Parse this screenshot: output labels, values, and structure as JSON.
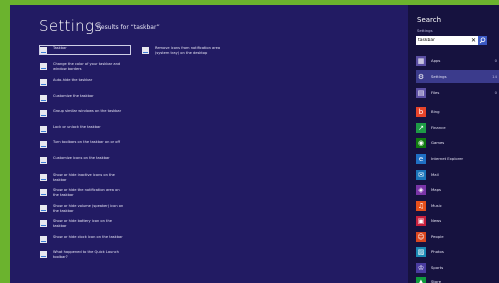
{
  "header": {
    "title": "Settings",
    "subtitle": "Results for “taskbar”"
  },
  "results_left": [
    "Taskbar",
    "Change the color of your taskbar and window borders",
    "Auto-hide the taskbar",
    "Customize the taskbar",
    "Group similar windows on the taskbar",
    "Lock or unlock the taskbar",
    "Turn toolbars on the taskbar on or off",
    "Customize icons on the taskbar",
    "Show or hide inactive icons on the taskbar",
    "Show or hide the notification area on the taskbar",
    "Show or hide volume (speaker) icon on the taskbar",
    "Show or hide battery icon on the taskbar",
    "Show or hide clock icon on the taskbar",
    "What happened to the Quick Launch toolbar?"
  ],
  "results_right": [
    "Remove icons from notification area (system tray) on the desktop"
  ],
  "charm": {
    "title": "Search",
    "scope": "Settings",
    "query": "taskbar",
    "clear_label": "✕",
    "apps": [
      {
        "label": "Apps",
        "count": "0",
        "icon": "apps-icon",
        "color": "#5b4fa3",
        "active": false
      },
      {
        "label": "Settings",
        "count": "14",
        "icon": "gear-icon",
        "color": "#3b3b8c",
        "active": true
      },
      {
        "label": "Files",
        "count": "0",
        "icon": "file-icon",
        "color": "#5b4fa3",
        "active": false
      },
      {
        "label": "Bing",
        "icon": "bing-icon",
        "color": "#e8442a",
        "active": false
      },
      {
        "label": "Finance",
        "icon": "finance-icon",
        "color": "#1e9a46",
        "active": false
      },
      {
        "label": "Games",
        "icon": "games-icon",
        "color": "#107c10",
        "active": false
      },
      {
        "label": "Internet Explorer",
        "icon": "internet-explorer-icon",
        "color": "#1f6fc4",
        "active": false
      },
      {
        "label": "Mail",
        "icon": "mail-icon",
        "color": "#1b75bb",
        "active": false
      },
      {
        "label": "Maps",
        "icon": "maps-icon",
        "color": "#7a35a8",
        "active": false
      },
      {
        "label": "Music",
        "icon": "music-icon",
        "color": "#e5501b",
        "active": false
      },
      {
        "label": "News",
        "icon": "news-icon",
        "color": "#c8203e",
        "active": false
      },
      {
        "label": "People",
        "icon": "people-icon",
        "color": "#d9471f",
        "active": false
      },
      {
        "label": "Photos",
        "icon": "photos-icon",
        "color": "#1a8ab5",
        "active": false
      },
      {
        "label": "Sports",
        "icon": "sports-icon",
        "color": "#4a3ca0",
        "active": false
      },
      {
        "label": "Store",
        "icon": "store-icon",
        "color": "#109c3e",
        "active": false
      }
    ]
  }
}
